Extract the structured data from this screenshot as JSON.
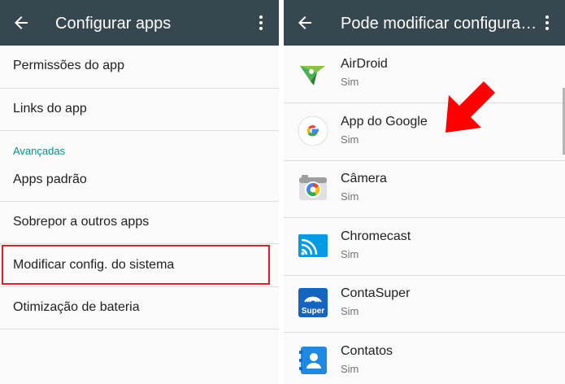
{
  "left_screen": {
    "title": "Configurar apps",
    "items": [
      {
        "label": "Permissões do app"
      },
      {
        "label": "Links do app"
      },
      {
        "label": "Apps padrão"
      },
      {
        "label": "Sobrepor a outros apps"
      },
      {
        "label": "Modificar config. do sistema"
      },
      {
        "label": "Otimização de bateria"
      }
    ],
    "section_header": "Avançadas",
    "highlighted_item": "Modificar config. do sistema"
  },
  "right_screen": {
    "title": "Pode modificar configura…",
    "apps": [
      {
        "name": "AirDroid",
        "status": "Sim",
        "icon": "airdroid-icon"
      },
      {
        "name": "App do Google",
        "status": "Sim",
        "icon": "google-icon"
      },
      {
        "name": "Câmera",
        "status": "Sim",
        "icon": "camera-icon"
      },
      {
        "name": "Chromecast",
        "status": "Sim",
        "icon": "chromecast-icon"
      },
      {
        "name": "ContaSuper",
        "status": "Sim",
        "icon": "contasuper-icon"
      },
      {
        "name": "Contatos",
        "status": "Sim",
        "icon": "contacts-icon"
      }
    ],
    "contasuper_icon_text": "Super"
  },
  "colors": {
    "app_bar": "#37474f",
    "accent": "#009688",
    "highlight": "#e11b22",
    "arrow": "#ff0000"
  },
  "icons": {
    "back": "arrow-back-icon",
    "overflow": "more-vert-icon",
    "annotation": "red-arrow-icon"
  }
}
